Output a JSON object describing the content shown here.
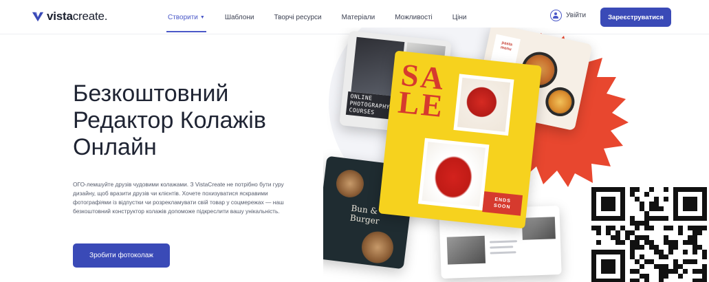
{
  "brand": {
    "logo_text_bold": "vista",
    "logo_text_light": "create.",
    "accent_color": "#3a4ab7",
    "secondary_accent": "#4a58c8"
  },
  "nav": {
    "items": [
      {
        "label": "Створити",
        "active": true
      },
      {
        "label": "Шаблони"
      },
      {
        "label": "Творчі ресурси"
      },
      {
        "label": "Матеріали"
      },
      {
        "label": "Можливості"
      },
      {
        "label": "Ціни"
      }
    ],
    "login_label": "Увійти",
    "signup_label": "Зареєструватися"
  },
  "hero": {
    "title_lines": [
      "Безкоштовний",
      "Редактор Колажів",
      "Онлайн"
    ],
    "description": "ОГО-лемшуйте друзів чудовими колажами. З VistaCreate не потрібно бути гуру дизайну, щоб вразити друзів чи клієнтів. Хочете похизуватися яскравими фотографіями із відпустки чи розрекламувати свій товар у соцмережах — наш безкоштовний конструктор колажів допоможе підкреслити вашу унікальність.",
    "cta_label": "Зробити фотоколаж"
  },
  "collage": {
    "photo_card_text": [
      "ONLINE",
      "PHOTOGRAPHY",
      "COURSES"
    ],
    "food_card_text": [
      "pasta",
      "menu"
    ],
    "dark_card_text": [
      "Bun &",
      "Burger"
    ],
    "sale_word": [
      "SA",
      "LE"
    ],
    "ends_tag": [
      "ENDS",
      "SOON"
    ]
  }
}
